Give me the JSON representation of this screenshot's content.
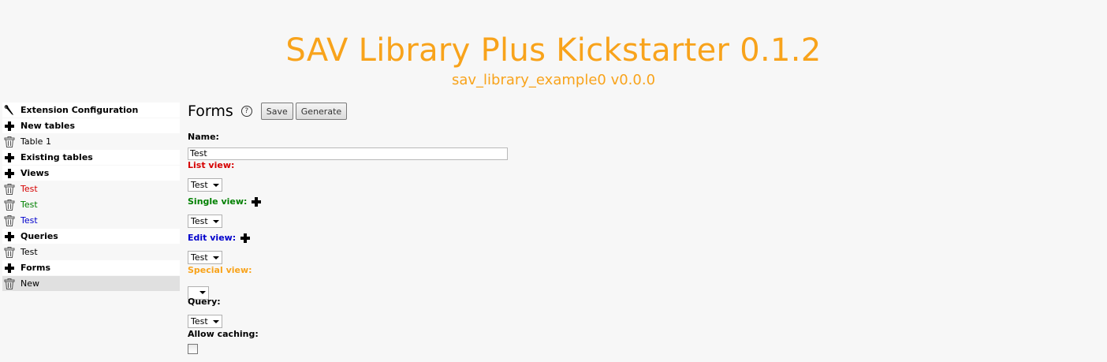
{
  "header": {
    "title": "SAV Library Plus Kickstarter 0.1.2",
    "subtitle": "sav_library_example0 v0.0.0"
  },
  "sidebar": {
    "items": [
      {
        "label": "Extension Configuration",
        "icon": "wrench-icon",
        "style": "bold"
      },
      {
        "label": "New tables",
        "icon": "plus-icon",
        "style": "bold"
      },
      {
        "label": "Table 1",
        "icon": "trash-icon",
        "style": "normal"
      },
      {
        "label": "Existing tables",
        "icon": "plus-icon",
        "style": "bold"
      },
      {
        "label": "Views",
        "icon": "plus-icon",
        "style": "bold"
      },
      {
        "label": "Test",
        "icon": "trash-icon",
        "style": "red"
      },
      {
        "label": "Test",
        "icon": "trash-icon",
        "style": "green"
      },
      {
        "label": "Test",
        "icon": "trash-icon",
        "style": "blue"
      },
      {
        "label": "Queries",
        "icon": "plus-icon",
        "style": "bold"
      },
      {
        "label": "Test",
        "icon": "trash-icon",
        "style": "normal"
      },
      {
        "label": "Forms",
        "icon": "plus-icon",
        "style": "bold"
      },
      {
        "label": "New",
        "icon": "trash-icon",
        "style": "selected"
      }
    ]
  },
  "form": {
    "title": "Forms",
    "help_icon": "?",
    "save_label": "Save",
    "generate_label": "Generate",
    "name_label": "Name:",
    "name_value": "Test",
    "list_view_label": "List view:",
    "list_view_value": "Test",
    "single_view_label": "Single view:",
    "single_view_value": "Test",
    "edit_view_label": "Edit view:",
    "edit_view_value": "Test",
    "special_view_label": "Special view:",
    "special_view_value": "",
    "query_label": "Query:",
    "query_value": "Test",
    "allow_caching_label": "Allow caching:",
    "allow_caching_checked": false
  },
  "colors": {
    "accent": "#f8a31b",
    "red": "#d60000",
    "green": "#008000",
    "blue": "#0000cc"
  }
}
